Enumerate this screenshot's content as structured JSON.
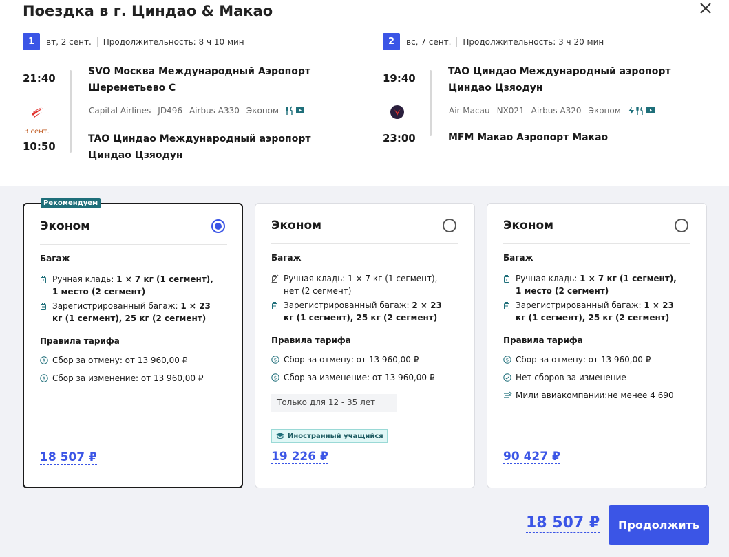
{
  "title": "Поездка в г. Циндао & Макао",
  "legs": [
    {
      "num": "1",
      "date": "вт, 2 сент.",
      "duration": "Продолжительность: 8 ч 10 мин",
      "dep_time": "21:40",
      "arr_time": "10:50",
      "arr_next_day": "3 сент.",
      "dep_airport": "SVO Москва Международный Аэропорт Шереметьево C",
      "arr_airport": "TAO Циндао Международный аэропорт Циндао Цзяодун",
      "airline": "Capital Airlines",
      "flight": "JD496",
      "aircraft": "Airbus A330",
      "cabin": "Эконом",
      "airline_icon": "capital-airlines-logo"
    },
    {
      "num": "2",
      "date": "вс, 7 сент.",
      "duration": "Продолжительность: 3 ч 20 мин",
      "dep_time": "19:40",
      "arr_time": "23:00",
      "dep_airport": "TAO Циндао Международный аэропорт Циндао Цзяодун",
      "arr_airport": "MFM Макао Аэропорт Макао",
      "airline": "Air Macau",
      "flight": "NX021",
      "aircraft": "Airbus A320",
      "cabin": "Эконом",
      "airline_icon": "air-macau-logo"
    }
  ],
  "fares": [
    {
      "badge": "Рекомендуем",
      "title": "Эконом",
      "baggage_title": "Багаж",
      "carry_on_label": "Ручная кладь: ",
      "carry_on_bold": "1 × 7 кг (1 сегмент), 1 место (2 сегмент)",
      "checked_label": "Зарегистрированный багаж: ",
      "checked_bold": "1 × 23 кг (1 сегмент), 25 кг (2 сегмент)",
      "rules_title": "Правила тарифа",
      "rule1": "Сбор за отмену: от 13 960,00 ₽",
      "rule2": "Сбор за изменение: от 13 960,00 ₽",
      "price": "18 507 ₽",
      "selected": true
    },
    {
      "title": "Эконом",
      "baggage_title": "Багаж",
      "carry_on_text": "Ручная кладь: 1 × 7 кг (1 сегмент), нет (2 сегмент)",
      "checked_label": "Зарегистрированный багаж: ",
      "checked_bold": "2 × 23 кг (1 сегмент), 25 кг (2 сегмент)",
      "rules_title": "Правила тарифа",
      "rule1": "Сбор за отмену: от 13 960,00 ₽",
      "rule2": "Сбор за изменение: от 13 960,00 ₽",
      "note": "Только для 12 - 35 лет",
      "tag": "Иностранный учащийся",
      "price": "19 226 ₽",
      "selected": false
    },
    {
      "title": "Эконом",
      "baggage_title": "Багаж",
      "carry_on_label": "Ручная кладь: ",
      "carry_on_bold": "1 × 7 кг (1 сегмент), 1 место (2 сегмент)",
      "checked_label": "Зарегистрированный багаж: ",
      "checked_bold": "1 × 23 кг (1 сегмент), 25 кг (2 сегмент)",
      "rules_title": "Правила тарифа",
      "rule1": "Сбор за отмену: от 13 960,00 ₽",
      "rule2": "Нет сборов за изменение",
      "rule3": "Мили авиакомпании:не менее 4 690",
      "price": "90 427 ₽",
      "selected": false
    }
  ],
  "footer": {
    "total": "18 507 ₽",
    "continue_label": "Продолжить"
  },
  "colors": {
    "accent": "#3b55e6",
    "badge": "#1f6f7a"
  }
}
